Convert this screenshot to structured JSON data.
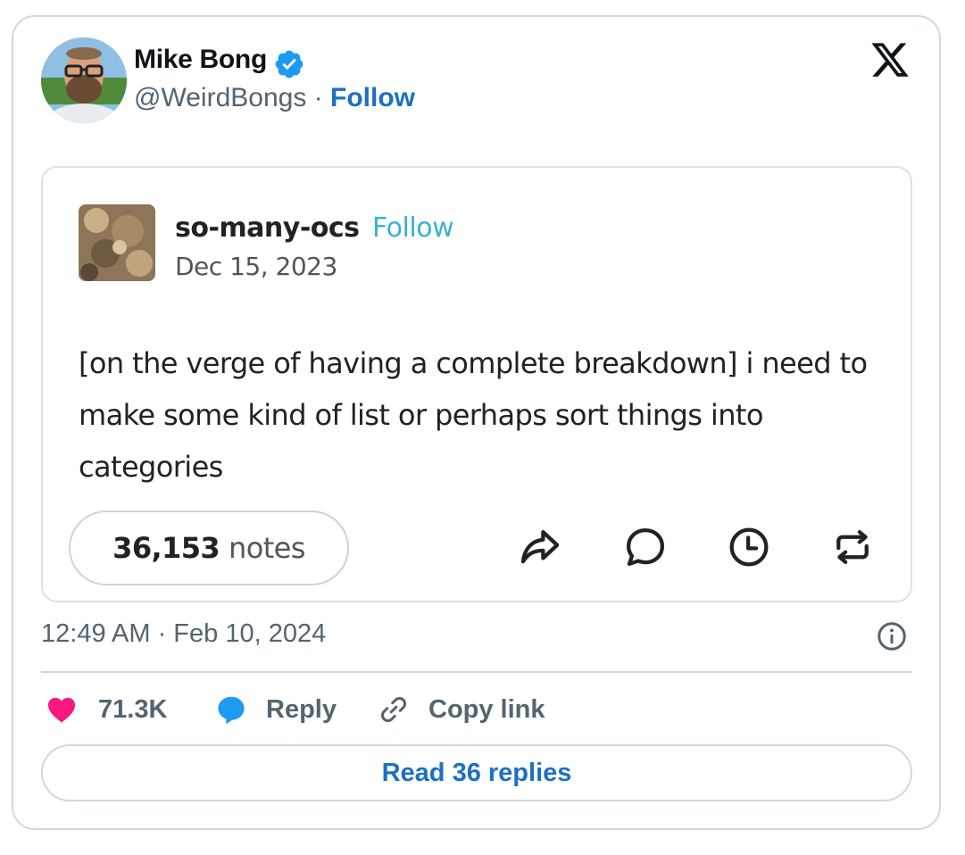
{
  "tweet": {
    "author": {
      "name": "Mike Bong",
      "handle": "@WeirdBongs",
      "separator": " · ",
      "follow_label": "Follow"
    },
    "timestamp": "12:49 AM · Feb 10, 2024",
    "likes": "71.3K",
    "reply_label": "Reply",
    "copy_link_label": "Copy link",
    "read_replies_label": "Read 36 replies"
  },
  "embed": {
    "blog_name": "so-many-ocs",
    "follow_label": "Follow",
    "date": "Dec 15, 2023",
    "text": "[on the verge of having a complete breakdown] i need to make some kind of list or perhaps sort things into categories",
    "notes_count": "36,153",
    "notes_label": "notes",
    "actions": [
      "share-icon",
      "comment-icon",
      "clock-icon",
      "reblog-icon"
    ]
  },
  "colors": {
    "link_blue": "#1d6fc4",
    "tumblr_follow": "#3ab1d0",
    "like_pink": "#f91880",
    "reply_blue": "#1d9bf0",
    "border": "#cfd9de",
    "muted_text": "#536471"
  }
}
